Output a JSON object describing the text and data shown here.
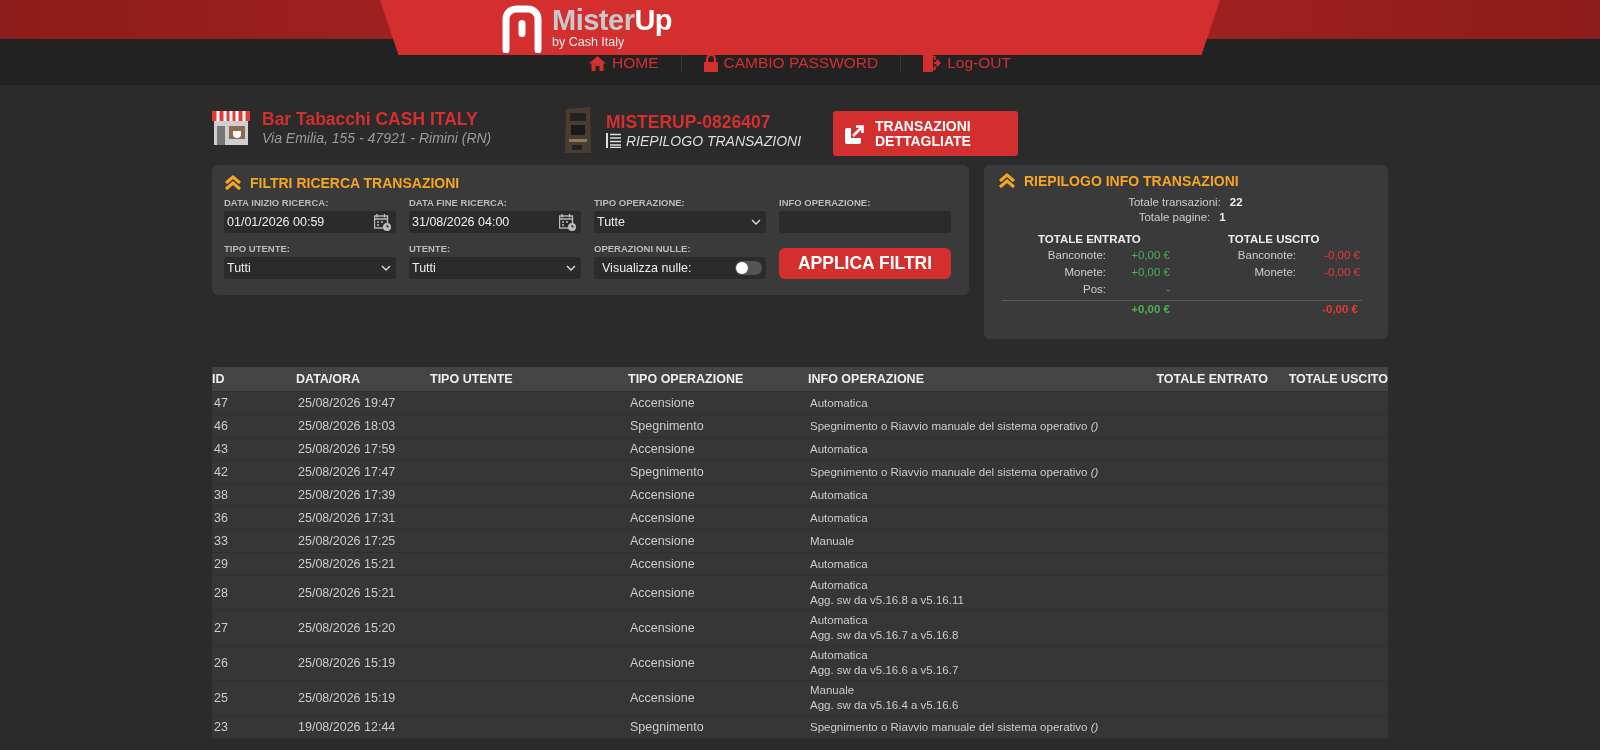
{
  "brand": {
    "first": "Mister",
    "second": "Up",
    "tagline": "by Cash Italy"
  },
  "nav": [
    {
      "label": "HOME",
      "kind": "home"
    },
    {
      "label": "CAMBIO PASSWORD",
      "kind": "lock"
    },
    {
      "label": "Log-OUT",
      "kind": "logout"
    }
  ],
  "shop": {
    "name": "Bar Tabacchi CASH ITALY",
    "address": "Via Emilia, 155 - 47921 - Rimini (RN)"
  },
  "machine": {
    "code": "MISTERUP-0826407",
    "view": "RIEPILOGO TRANSAZIONI"
  },
  "detail_button": {
    "line1": "TRANSAZIONI",
    "line2": "DETTAGLIATE"
  },
  "filters": {
    "title": "FILTRI RICERCA TRANSAZIONI",
    "fields": [
      {
        "label": "DATA INIZIO RICERCA:",
        "kind": "date",
        "value": "01/01/2026 00:59"
      },
      {
        "label": "DATA FINE RICERCA:",
        "kind": "date",
        "value": "31/08/2026 04:00"
      },
      {
        "label": "TIPO OPERAZIONE:",
        "kind": "select",
        "value": "Tutte"
      },
      {
        "label": "INFO OPERAZIONE:",
        "kind": "text"
      },
      {
        "label": "TIPO UTENTE:",
        "kind": "select",
        "value": "Tutti"
      },
      {
        "label": "UTENTE:",
        "kind": "select",
        "value": "Tutti"
      },
      {
        "label": "OPERAZIONI NULLE:",
        "kind": "toggle",
        "value": "Visualizza nulle:",
        "on": false
      },
      {
        "label": "APPLICA FILTRI",
        "kind": "button"
      }
    ]
  },
  "summary": {
    "title": "RIEPILOGO INFO TRANSAZIONI",
    "stats": [
      {
        "label": "Totale transazioni:",
        "value": "22"
      },
      {
        "label": "Totale pagine:",
        "value": "1"
      }
    ],
    "sections": [
      {
        "title": "TOTALE ENTRATO",
        "kind": "in",
        "rows": [
          {
            "label": "Banconote:",
            "value": "+0,00 €"
          },
          {
            "label": "Monete:",
            "value": "+0,00 €"
          },
          {
            "label": "Pos:",
            "value": "-"
          }
        ],
        "total": "+0,00 €"
      },
      {
        "title": "TOTALE USCITO",
        "kind": "out",
        "rows": [
          {
            "label": "Banconote:",
            "value": "-0,00 €"
          },
          {
            "label": "Monete:",
            "value": "-0,00 €"
          }
        ],
        "total": "-0,00 €"
      }
    ]
  },
  "table": {
    "columns": [
      "ID",
      "DATA/ORA",
      "TIPO UTENTE",
      "TIPO OPERAZIONE",
      "INFO OPERAZIONE",
      "TOTALE ENTRATO",
      "TOTALE USCITO"
    ],
    "rows": [
      {
        "id": "47",
        "date": "25/08/2026 19:47",
        "operation": "Accensione",
        "info": [
          "Automatica"
        ]
      },
      {
        "id": "46",
        "date": "25/08/2026 18:03",
        "operation": "Spegnimento",
        "info": [
          "Spegnimento o Riavvio manuale del sistema operativo *()*"
        ]
      },
      {
        "id": "43",
        "date": "25/08/2026 17:59",
        "operation": "Accensione",
        "info": [
          "Automatica"
        ]
      },
      {
        "id": "42",
        "date": "25/08/2026 17:47",
        "operation": "Spegnimento",
        "info": [
          "Spegnimento o Riavvio manuale del sistema operativo *()*"
        ]
      },
      {
        "id": "38",
        "date": "25/08/2026 17:39",
        "operation": "Accensione",
        "info": [
          "Automatica"
        ]
      },
      {
        "id": "36",
        "date": "25/08/2026 17:31",
        "operation": "Accensione",
        "info": [
          "Automatica"
        ]
      },
      {
        "id": "33",
        "date": "25/08/2026 17:25",
        "operation": "Accensione",
        "info": [
          "Manuale"
        ]
      },
      {
        "id": "29",
        "date": "25/08/2026 15:21",
        "operation": "Accensione",
        "info": [
          "Automatica"
        ]
      },
      {
        "id": "28",
        "date": "25/08/2026 15:21",
        "operation": "Accensione",
        "info": [
          "Automatica",
          "Agg. sw da v5.16.8 a v5.16.11"
        ]
      },
      {
        "id": "27",
        "date": "25/08/2026 15:20",
        "operation": "Accensione",
        "info": [
          "Automatica",
          "Agg. sw da v5.16.7 a v5.16.8"
        ]
      },
      {
        "id": "26",
        "date": "25/08/2026 15:19",
        "operation": "Accensione",
        "info": [
          "Automatica",
          "Agg. sw da v5.16.6 a v5.16.7"
        ]
      },
      {
        "id": "25",
        "date": "25/08/2026 15:19",
        "operation": "Accensione",
        "info": [
          "Manuale",
          "Agg. sw da v5.16.4 a v5.16.6"
        ]
      },
      {
        "id": "23",
        "date": "19/08/2026 12:44",
        "operation": "Spegnimento",
        "info": [
          "Spegnimento o Riavvio manuale del sistema operativo *()*"
        ]
      }
    ]
  }
}
